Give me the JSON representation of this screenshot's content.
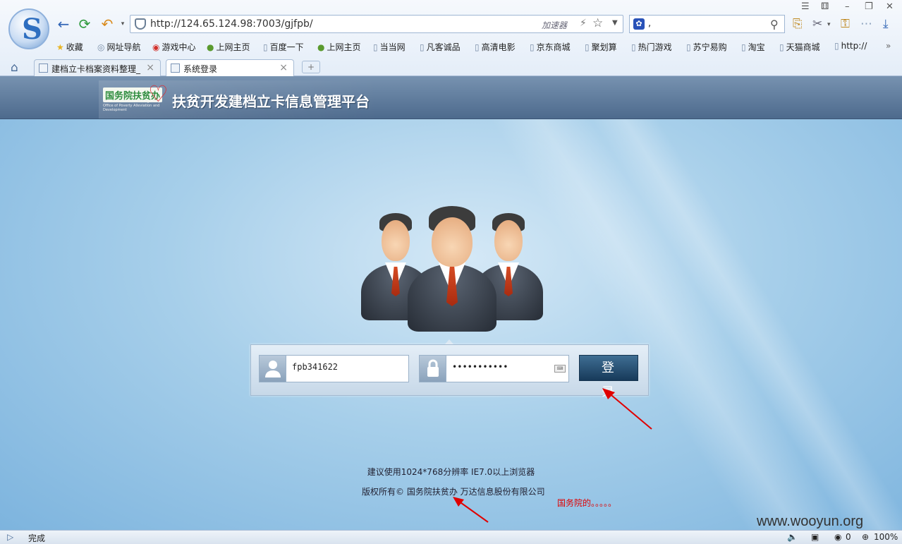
{
  "browser": {
    "url": "http://124.65.124.98:7003/gjfpb/",
    "accelerator_label": "加速器",
    "search_value": ","
  },
  "bookmarks": [
    {
      "label": "收藏",
      "icon": "star-icon"
    },
    {
      "label": "网址导航",
      "icon": "globe-icon"
    },
    {
      "label": "游戏中心",
      "icon": "game-icon"
    },
    {
      "label": "上网主页",
      "icon": "hao-icon"
    },
    {
      "label": "百度一下",
      "icon": "page-icon"
    },
    {
      "label": "上网主页",
      "icon": "hao-icon"
    },
    {
      "label": "当当网",
      "icon": "page-icon"
    },
    {
      "label": "凡客诚品",
      "icon": "page-icon"
    },
    {
      "label": "高清电影",
      "icon": "page-icon"
    },
    {
      "label": "京东商城",
      "icon": "page-icon"
    },
    {
      "label": "聚划算",
      "icon": "page-icon"
    },
    {
      "label": "热门游戏",
      "icon": "page-icon"
    },
    {
      "label": "苏宁易购",
      "icon": "page-icon"
    },
    {
      "label": "淘宝",
      "icon": "page-icon"
    },
    {
      "label": "天猫商城",
      "icon": "page-icon"
    },
    {
      "label": "http://",
      "icon": "page-icon"
    }
  ],
  "tabs": [
    {
      "label": "建档立卡档案资料整理_"
    },
    {
      "label": "系统登录"
    }
  ],
  "page": {
    "logo_text": "国务院扶贫办",
    "logo_subtext": "The State Council Leading Group Office of Poverty Alleviation and Development",
    "title": "扶贫开发建档立卡信息管理平台",
    "username": "fpb341622",
    "password": "•••••••••••",
    "login_label": "登 录",
    "note_resolution": "建议使用1024*768分辨率 IE7.0以上浏览器",
    "copyright": "版权所有©  国务院扶贫办 万达信息股份有限公司",
    "red_annotation": "国务院的。。。。。",
    "watermark": "www.wooyun.org"
  },
  "status": {
    "text": "完成",
    "downloads": "0",
    "zoom": "100%"
  },
  "colors": {
    "header_bg": "#5c7899",
    "login_button": "#1f4566",
    "annotation_red": "#e00000"
  }
}
